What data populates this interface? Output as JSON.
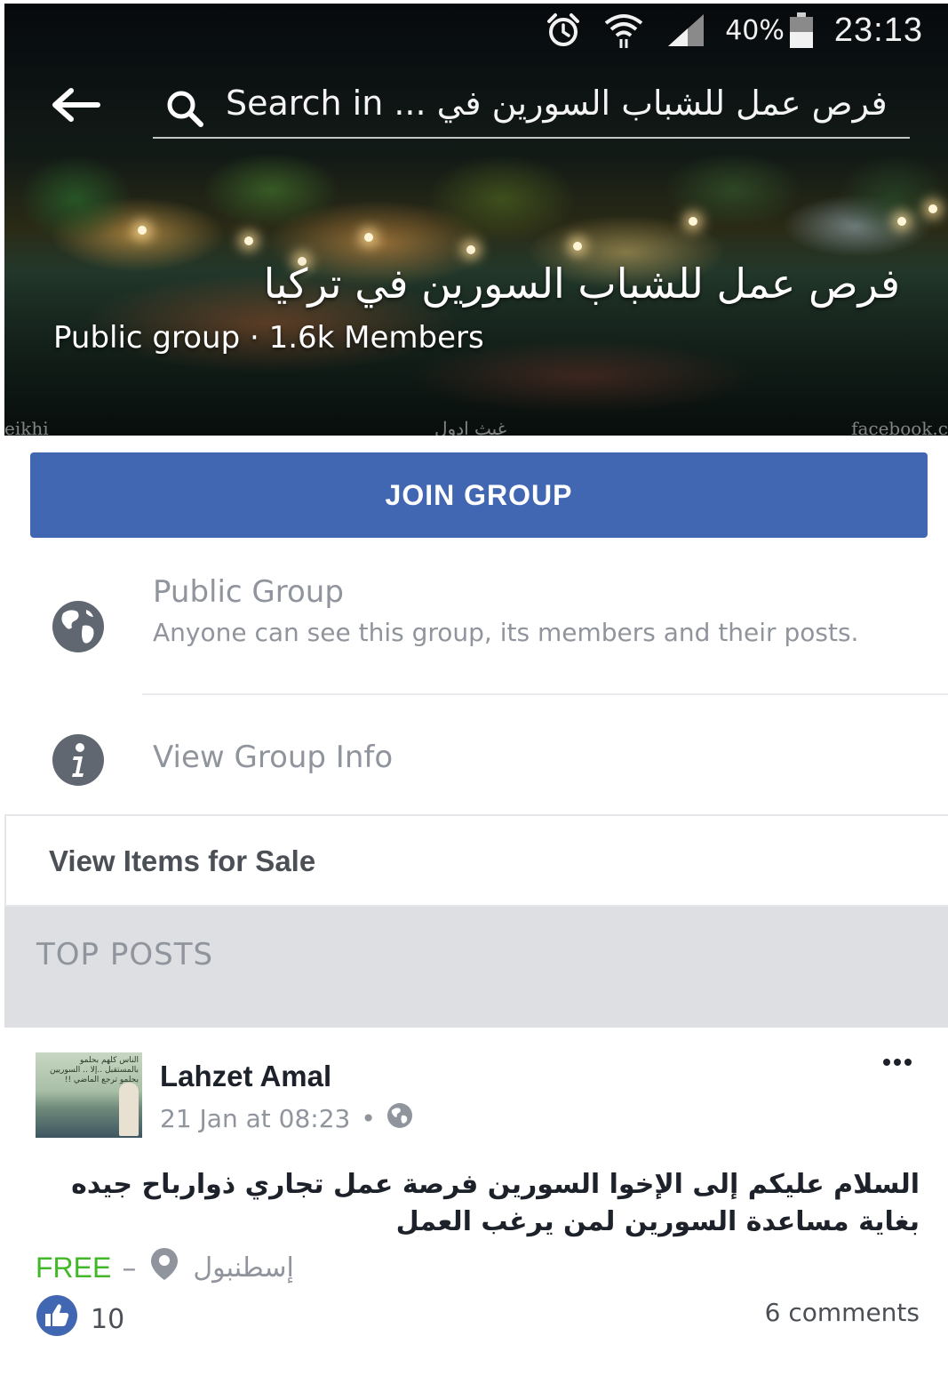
{
  "status_bar": {
    "battery_percent": "40%",
    "time": "23:13",
    "icons": [
      "alarm-icon",
      "wifi-icon",
      "signal-icon",
      "battery-icon"
    ]
  },
  "search": {
    "text": "Search in ... فرص عمل للشباب السورين في"
  },
  "cover": {
    "title": "فرص عمل للشباب السورين في تركيا",
    "subtitle": "Public group · 1.6k Members",
    "watermark_left": "eikhi",
    "watermark_center": "غيث ادول",
    "watermark_right": "facebook.c"
  },
  "join_button": {
    "label": "JOIN GROUP",
    "color": "#4267b2"
  },
  "privacy": {
    "title": "Public Group",
    "description": "Anyone can see this group, its members and their posts."
  },
  "group_info": {
    "label": "View Group Info"
  },
  "sale": {
    "label": "View Items for Sale"
  },
  "section": {
    "label": "TOP POSTS"
  },
  "post": {
    "author": "Lahzet Amal",
    "timestamp": "21 Jan at 08:23",
    "separator": "•",
    "avatar_caption": "الناس كلهم بحلمو بالمستقبل ..إلا .. السوريين بحلمو ترجع الماضي !!",
    "body": "السلام عليكم إلى الإخوا السورين فرصة عمل تجاري ذوارباح جيده بغاية مساعدة السورين لمن يرغب العمل",
    "price": "FREE",
    "price_separator": "–",
    "location": "إسطنبول",
    "likes": "10",
    "comments": "6 comments",
    "colors": {
      "price": "#42b72a",
      "like": "#4267b2"
    }
  }
}
